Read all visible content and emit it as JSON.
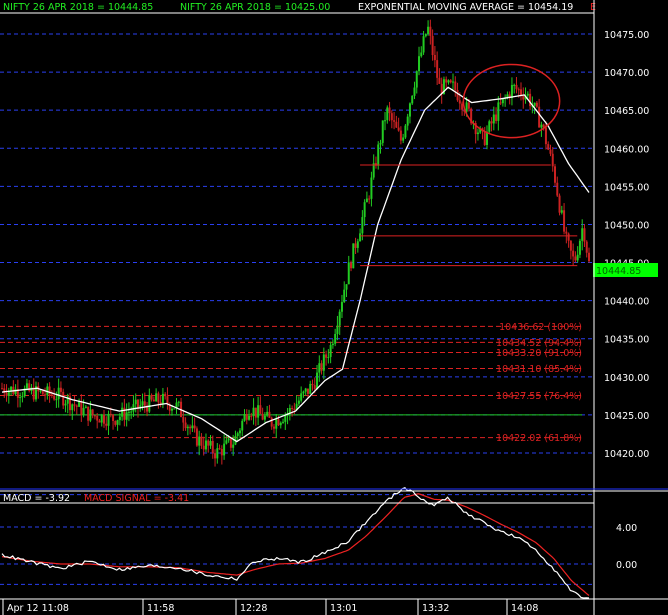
{
  "colors": {
    "background": "#000000",
    "border": "#ffffff",
    "grid": "#2a3ff0",
    "candle_up": "#22cc22",
    "candle_down": "#cc2222",
    "ema_line": "#ffffff",
    "fib_line": "#dd2222",
    "price_badge_bg": "#00ff00",
    "macd_line": "#ffffff",
    "signal_line": "#ee2222",
    "header_green": "#22ee22",
    "header_white": "#ffffff",
    "macd_text": "#ffffff",
    "signal_text": "#ee2222"
  },
  "header": {
    "series1": "NIFTY 26 APR 2018 = 10444.85",
    "series2": "NIFTY 26 APR 2018 = 10425.00",
    "ema": "EXPONENTIAL MOVING AVERAGE = 10454.19",
    "corner_mark": "E"
  },
  "macd_header": {
    "macd": "MACD = -3.92",
    "signal": "MACD SIGNAL = -3.41"
  },
  "price_badge": "10444.85",
  "x_axis_labels": [
    "Apr 12 11:08",
    "11:58",
    "12:28",
    "13:01",
    "13:32",
    "14:08"
  ],
  "chart_data": [
    {
      "type": "candlestick",
      "title": "NIFTY 26 APR 2018",
      "y_ticks": [
        10420,
        10425,
        10430,
        10435,
        10440,
        10445,
        10450,
        10455,
        10460,
        10465,
        10470,
        10475
      ],
      "y_tick_labels": [
        "10420.00",
        "10425.00",
        "10430.00",
        "10435.00",
        "10440.00",
        "10445.00",
        "10450.00",
        "10455.00",
        "10460.00",
        "10465.00",
        "10470.00",
        "10475.00"
      ],
      "ylim": [
        10415.3,
        10477.8
      ],
      "grid": true,
      "last_price": 10444.85,
      "ema_last": 10454.19,
      "reference_line": 10425.0,
      "fib_levels": [
        {
          "value": 10436.62,
          "label": "10436.62 (100%)"
        },
        {
          "value": 10434.52,
          "label": "10434.52 (94.4%)"
        },
        {
          "value": 10433.2,
          "label": "10433.20 (91.0%)"
        },
        {
          "value": 10431.1,
          "label": "10431.10 (85.4%)"
        },
        {
          "value": 10427.55,
          "label": "10427.55 (76.4%)"
        },
        {
          "value": 10422.02,
          "label": "10422.02 (61.8%)"
        }
      ],
      "price_keypoints": [
        {
          "t": 0.0,
          "v": 10428.5
        },
        {
          "t": 0.05,
          "v": 10428.0
        },
        {
          "t": 0.1,
          "v": 10427.5
        },
        {
          "t": 0.15,
          "v": 10425.0
        },
        {
          "t": 0.19,
          "v": 10424.5
        },
        {
          "t": 0.23,
          "v": 10426.0
        },
        {
          "t": 0.27,
          "v": 10427.0
        },
        {
          "t": 0.3,
          "v": 10426.0
        },
        {
          "t": 0.33,
          "v": 10422.0
        },
        {
          "t": 0.365,
          "v": 10420.0
        },
        {
          "t": 0.395,
          "v": 10421.5
        },
        {
          "t": 0.42,
          "v": 10426.0
        },
        {
          "t": 0.46,
          "v": 10424.0
        },
        {
          "t": 0.49,
          "v": 10425.5
        },
        {
          "t": 0.53,
          "v": 10429.0
        },
        {
          "t": 0.56,
          "v": 10434.0
        },
        {
          "t": 0.59,
          "v": 10444.0
        },
        {
          "t": 0.625,
          "v": 10454.0
        },
        {
          "t": 0.655,
          "v": 10465.0
        },
        {
          "t": 0.68,
          "v": 10461.0
        },
        {
          "t": 0.7,
          "v": 10468.0
        },
        {
          "t": 0.725,
          "v": 10476.0
        },
        {
          "t": 0.745,
          "v": 10468.0
        },
        {
          "t": 0.77,
          "v": 10468.0
        },
        {
          "t": 0.8,
          "v": 10464.0
        },
        {
          "t": 0.82,
          "v": 10461.0
        },
        {
          "t": 0.845,
          "v": 10465.0
        },
        {
          "t": 0.87,
          "v": 10468.0
        },
        {
          "t": 0.895,
          "v": 10467.0
        },
        {
          "t": 0.92,
          "v": 10463.0
        },
        {
          "t": 0.94,
          "v": 10457.0
        },
        {
          "t": 0.96,
          "v": 10448.0
        },
        {
          "t": 0.975,
          "v": 10445.0
        },
        {
          "t": 0.99,
          "v": 10450.0
        },
        {
          "t": 1.0,
          "v": 10444.85
        }
      ],
      "ema_keypoints": [
        {
          "t": 0.0,
          "v": 10428.0
        },
        {
          "t": 0.06,
          "v": 10428.5
        },
        {
          "t": 0.12,
          "v": 10427.0
        },
        {
          "t": 0.2,
          "v": 10425.5
        },
        {
          "t": 0.28,
          "v": 10426.5
        },
        {
          "t": 0.34,
          "v": 10424.5
        },
        {
          "t": 0.4,
          "v": 10421.5
        },
        {
          "t": 0.45,
          "v": 10424.0
        },
        {
          "t": 0.5,
          "v": 10425.5
        },
        {
          "t": 0.55,
          "v": 10429.5
        },
        {
          "t": 0.58,
          "v": 10431.0
        },
        {
          "t": 0.61,
          "v": 10440.0
        },
        {
          "t": 0.64,
          "v": 10450.0
        },
        {
          "t": 0.68,
          "v": 10458.5
        },
        {
          "t": 0.72,
          "v": 10465.0
        },
        {
          "t": 0.76,
          "v": 10468.0
        },
        {
          "t": 0.8,
          "v": 10466.0
        },
        {
          "t": 0.85,
          "v": 10466.5
        },
        {
          "t": 0.89,
          "v": 10467.0
        },
        {
          "t": 0.93,
          "v": 10463.0
        },
        {
          "t": 0.965,
          "v": 10458.0
        },
        {
          "t": 1.0,
          "v": 10454.19
        }
      ],
      "annotations": {
        "hline_segments": [
          {
            "v": 10457.8,
            "t0": 0.61,
            "t1": 0.935
          },
          {
            "v": 10448.5,
            "t0": 0.61,
            "t1": 0.98
          },
          {
            "v": 10444.6,
            "t0": 0.61,
            "t1": 0.98
          }
        ],
        "circle": {
          "t_center": 0.868,
          "v_center": 10466.2,
          "t_radius": 0.082,
          "v_radius": 4.8
        }
      }
    },
    {
      "type": "line",
      "title": "MACD",
      "y_tick_labels": [
        "4.00",
        "0.00"
      ],
      "y_ticks": [
        4,
        0
      ],
      "ylim": [
        -3.92,
        8.8
      ],
      "grid": true,
      "series": [
        {
          "name": "MACD",
          "keypoints": [
            {
              "t": 0.0,
              "v": 1.0
            },
            {
              "t": 0.05,
              "v": 0.2
            },
            {
              "t": 0.1,
              "v": -0.5
            },
            {
              "t": 0.15,
              "v": 0.3
            },
            {
              "t": 0.2,
              "v": -0.6
            },
            {
              "t": 0.25,
              "v": -0.2
            },
            {
              "t": 0.3,
              "v": -0.4
            },
            {
              "t": 0.35,
              "v": -1.2
            },
            {
              "t": 0.4,
              "v": -1.6
            },
            {
              "t": 0.43,
              "v": 0.3
            },
            {
              "t": 0.47,
              "v": 0.6
            },
            {
              "t": 0.51,
              "v": 0.2
            },
            {
              "t": 0.55,
              "v": 1.2
            },
            {
              "t": 0.59,
              "v": 2.5
            },
            {
              "t": 0.62,
              "v": 4.5
            },
            {
              "t": 0.655,
              "v": 6.8
            },
            {
              "t": 0.685,
              "v": 8.3
            },
            {
              "t": 0.71,
              "v": 7.3
            },
            {
              "t": 0.735,
              "v": 6.3
            },
            {
              "t": 0.76,
              "v": 7.2
            },
            {
              "t": 0.79,
              "v": 5.5
            },
            {
              "t": 0.82,
              "v": 4.5
            },
            {
              "t": 0.85,
              "v": 3.5
            },
            {
              "t": 0.88,
              "v": 2.8
            },
            {
              "t": 0.91,
              "v": 1.5
            },
            {
              "t": 0.94,
              "v": -0.5
            },
            {
              "t": 0.97,
              "v": -3.0
            },
            {
              "t": 1.0,
              "v": -3.92
            }
          ]
        },
        {
          "name": "MACD SIGNAL",
          "keypoints": [
            {
              "t": 0.0,
              "v": 0.8
            },
            {
              "t": 0.05,
              "v": 0.3
            },
            {
              "t": 0.1,
              "v": 0.0
            },
            {
              "t": 0.15,
              "v": 0.0
            },
            {
              "t": 0.2,
              "v": -0.3
            },
            {
              "t": 0.25,
              "v": -0.3
            },
            {
              "t": 0.3,
              "v": -0.4
            },
            {
              "t": 0.35,
              "v": -0.9
            },
            {
              "t": 0.4,
              "v": -1.2
            },
            {
              "t": 0.43,
              "v": -0.6
            },
            {
              "t": 0.47,
              "v": 0.0
            },
            {
              "t": 0.51,
              "v": 0.1
            },
            {
              "t": 0.55,
              "v": 0.6
            },
            {
              "t": 0.59,
              "v": 1.5
            },
            {
              "t": 0.62,
              "v": 3.0
            },
            {
              "t": 0.655,
              "v": 5.2
            },
            {
              "t": 0.685,
              "v": 7.2
            },
            {
              "t": 0.71,
              "v": 7.6
            },
            {
              "t": 0.735,
              "v": 7.0
            },
            {
              "t": 0.76,
              "v": 6.9
            },
            {
              "t": 0.79,
              "v": 6.2
            },
            {
              "t": 0.82,
              "v": 5.3
            },
            {
              "t": 0.85,
              "v": 4.3
            },
            {
              "t": 0.88,
              "v": 3.4
            },
            {
              "t": 0.91,
              "v": 2.3
            },
            {
              "t": 0.94,
              "v": 0.6
            },
            {
              "t": 0.97,
              "v": -1.8
            },
            {
              "t": 1.0,
              "v": -3.41
            }
          ]
        }
      ]
    }
  ]
}
